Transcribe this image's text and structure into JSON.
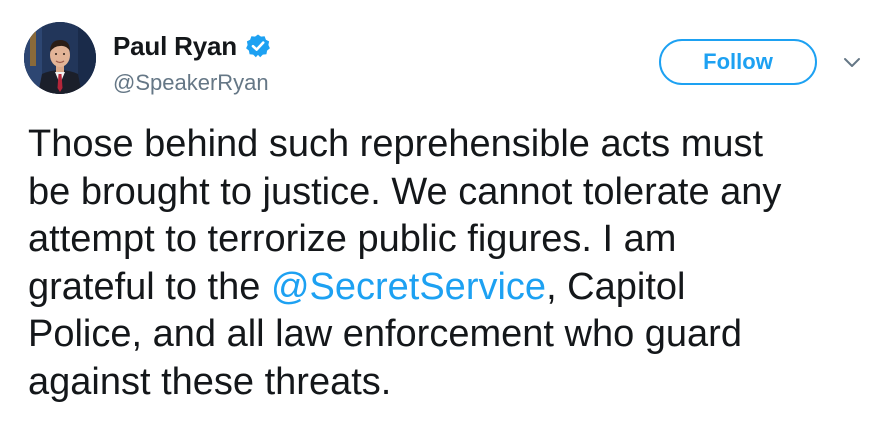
{
  "user": {
    "display_name": "Paul Ryan",
    "handle": "@SpeakerRyan",
    "verified": true
  },
  "actions": {
    "follow_label": "Follow",
    "menu_icon": "chevron-down-icon"
  },
  "tweet": {
    "lines": [
      {
        "parts": [
          {
            "text": "Those behind such reprehensible acts must"
          }
        ]
      },
      {
        "parts": [
          {
            "text": "be brought to justice. We cannot tolerate any"
          }
        ]
      },
      {
        "parts": [
          {
            "text": "attempt to terrorize public figures. I am"
          }
        ]
      },
      {
        "parts": [
          {
            "text": "grateful to the "
          },
          {
            "text": "@SecretService"
          },
          {
            "text": ", Capitol"
          }
        ]
      },
      {
        "parts": [
          {
            "text": "Police, and all law enforcement who guard"
          }
        ]
      },
      {
        "parts": [
          {
            "text": "against these threats."
          }
        ]
      }
    ]
  },
  "colors": {
    "accent": "#1da1f2",
    "text": "#14171a",
    "secondary_text": "#657786"
  }
}
